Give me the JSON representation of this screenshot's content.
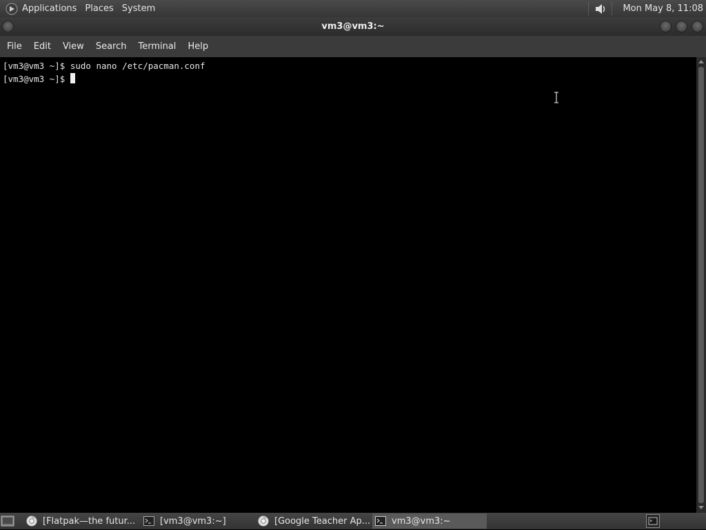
{
  "top_panel": {
    "menus": [
      "Applications",
      "Places",
      "System"
    ],
    "clock": "Mon May  8, 11:08"
  },
  "window": {
    "title": "vm3@vm3:~"
  },
  "menubar": {
    "items": [
      "File",
      "Edit",
      "View",
      "Search",
      "Terminal",
      "Help"
    ]
  },
  "terminal": {
    "lines": [
      "[vm3@vm3 ~]$ sudo nano /etc/pacman.conf",
      "[vm3@vm3 ~]$ "
    ]
  },
  "taskbar": {
    "tasks": [
      {
        "label": "[Flatpak—the futur...",
        "icon": "chrome-icon",
        "active": false
      },
      {
        "label": "[vm3@vm3:~]",
        "icon": "terminal-icon",
        "active": false
      },
      {
        "label": "[Google Teacher Ap...",
        "icon": "chrome-icon",
        "active": false
      },
      {
        "label": "vm3@vm3:~",
        "icon": "terminal-icon",
        "active": true
      }
    ]
  },
  "colors": {
    "terminal_bg": "#000000",
    "terminal_fg": "#e8e8e8",
    "panel_bg": "#3c3c3c",
    "active_task": "#5a5a5a"
  }
}
